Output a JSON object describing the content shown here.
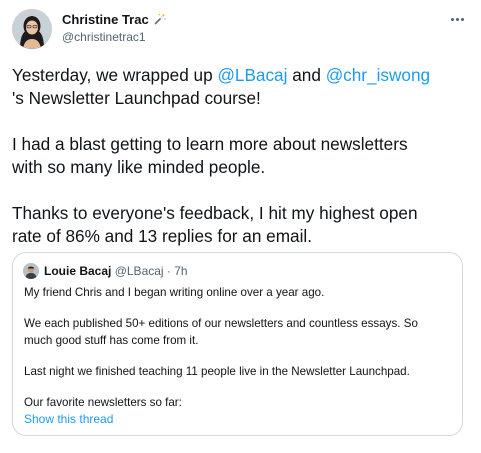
{
  "tweet": {
    "author": {
      "name": "Christine Trac",
      "handle": "@christinetrac1",
      "badge_icon": "magic-wand-icon"
    },
    "more_icon": "more-dots-icon",
    "body": {
      "line1_part1": "Yesterday, we wrapped up ",
      "mention1": "@LBacaj",
      "line1_part2": " and ",
      "mention2": "@chr_iswong",
      "line2": "'s Newsletter Launchpad course!",
      "para2_line1": "I had a blast getting to learn more about newsletters",
      "para2_line2": "with so many like minded people.",
      "para3_line1": "Thanks to everyone's feedback, I hit my highest open",
      "para3_line2": "rate of 86% and 13 replies for an email."
    },
    "quote": {
      "author_name": "Louie Bacaj",
      "author_handle": "@LBacaj",
      "separator": " · ",
      "time": "7h",
      "p1": "My friend Chris and I began writing online over a year ago.",
      "p2_line1": "We each published 50+ editions of our newsletters and countless essays. So",
      "p2_line2": "much good stuff has come from it.",
      "p3": "Last night we finished teaching 11 people live in the Newsletter Launchpad.",
      "p4": "Our favorite newsletters so far:",
      "show_thread": "Show this thread"
    },
    "colors": {
      "text": "#0f1419",
      "secondary": "#536471",
      "link": "#1d9bf0",
      "border": "#cfd9de"
    }
  }
}
